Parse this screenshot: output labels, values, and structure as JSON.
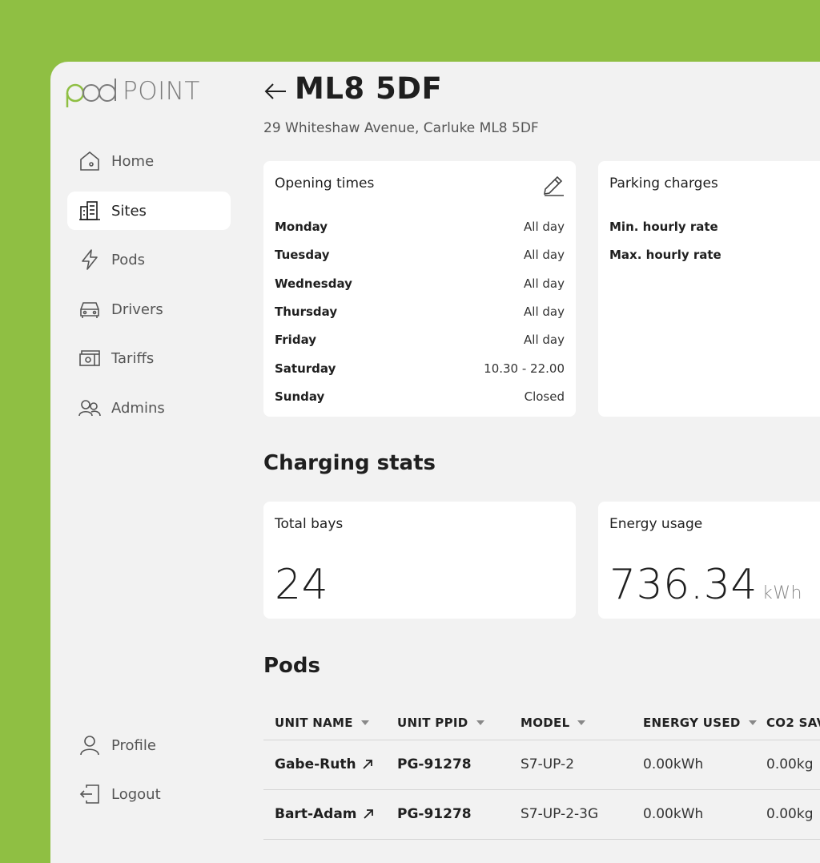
{
  "brand": {
    "logo_word_1": "pod",
    "logo_word_2": "POINT",
    "accent": "#8fbf43"
  },
  "sidebar": {
    "items": [
      {
        "label": "Home",
        "icon": "home-icon",
        "active": false
      },
      {
        "label": "Sites",
        "icon": "building-icon",
        "active": true
      },
      {
        "label": "Pods",
        "icon": "lightning-icon",
        "active": false
      },
      {
        "label": "Drivers",
        "icon": "car-icon",
        "active": false
      },
      {
        "label": "Tariffs",
        "icon": "cash-icon",
        "active": false
      },
      {
        "label": "Admins",
        "icon": "users-icon",
        "active": false
      }
    ],
    "bottom": [
      {
        "label": "Profile",
        "icon": "user-icon"
      },
      {
        "label": "Logout",
        "icon": "logout-icon"
      }
    ]
  },
  "header": {
    "title": "ML8 5DF",
    "address": "29 Whiteshaw Avenue, Carluke ML8 5DF"
  },
  "opening_times": {
    "title": "Opening times",
    "rows": [
      {
        "day": "Monday",
        "value": "All day"
      },
      {
        "day": "Tuesday",
        "value": "All day"
      },
      {
        "day": "Wednesday",
        "value": "All day"
      },
      {
        "day": "Thursday",
        "value": "All day"
      },
      {
        "day": "Friday",
        "value": "All day"
      },
      {
        "day": "Saturday",
        "value": "10.30 - 22.00"
      },
      {
        "day": "Sunday",
        "value": "Closed"
      }
    ]
  },
  "parking": {
    "title": "Parking charges",
    "rows": [
      {
        "label": "Min. hourly rate"
      },
      {
        "label": "Max. hourly rate"
      }
    ]
  },
  "charging_stats": {
    "title": "Charging stats",
    "total_bays_label": "Total bays",
    "total_bays_value": "24",
    "energy_label": "Energy usage",
    "energy_value": "736.34",
    "energy_unit": "kWh"
  },
  "pods": {
    "title": "Pods",
    "columns": [
      "UNIT NAME",
      "UNIT PPID",
      "MODEL",
      "ENERGY USED",
      "CO2 SAV"
    ],
    "rows": [
      {
        "unit_name": "Gabe-Ruth",
        "ppid": "PG-91278",
        "model": "S7-UP-2",
        "energy": "0.00kWh",
        "co2": "0.00kg"
      },
      {
        "unit_name": "Bart-Adam",
        "ppid": "PG-91278",
        "model": "S7-UP-2-3G",
        "energy": "0.00kWh",
        "co2": "0.00kg"
      }
    ]
  }
}
